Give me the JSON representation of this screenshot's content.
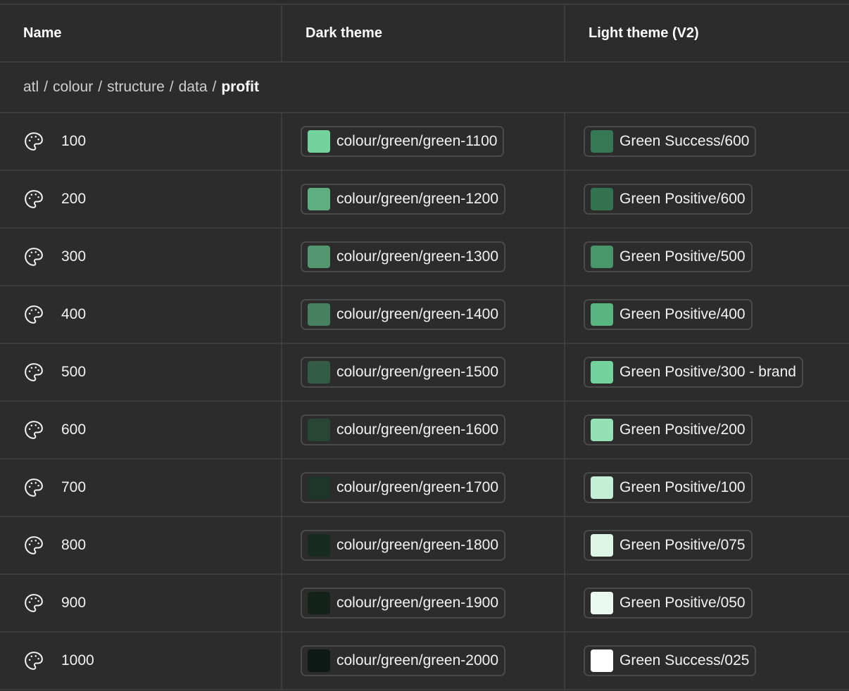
{
  "header": {
    "name": "Name",
    "dark": "Dark theme",
    "light": "Light theme (V2)"
  },
  "breadcrumb": {
    "parts": [
      "atl",
      "colour",
      "structure",
      "data"
    ],
    "separator": "/",
    "current": "profit"
  },
  "icon": "palette-icon",
  "rows": [
    {
      "name": "100",
      "dark": {
        "label": "colour/green/green-1100",
        "color": "#73d39c"
      },
      "light": {
        "label": "Green Success/600",
        "color": "#357853"
      }
    },
    {
      "name": "200",
      "dark": {
        "label": "colour/green/green-1200",
        "color": "#5fae80"
      },
      "light": {
        "label": "Green Positive/600",
        "color": "#337350"
      }
    },
    {
      "name": "300",
      "dark": {
        "label": "colour/green/green-1300",
        "color": "#53966f"
      },
      "light": {
        "label": "Green Positive/500",
        "color": "#48966a"
      }
    },
    {
      "name": "400",
      "dark": {
        "label": "colour/green/green-1400",
        "color": "#46805f"
      },
      "light": {
        "label": "Green Positive/400",
        "color": "#5ab680"
      }
    },
    {
      "name": "500",
      "dark": {
        "label": "colour/green/green-1500",
        "color": "#345b45"
      },
      "light": {
        "label": "Green Positive/300 - brand",
        "color": "#73d39c"
      }
    },
    {
      "name": "600",
      "dark": {
        "label": "colour/green/green-1600",
        "color": "#284535"
      },
      "light": {
        "label": "Green Positive/200",
        "color": "#95e0b5"
      }
    },
    {
      "name": "700",
      "dark": {
        "label": "colour/green/green-1700",
        "color": "#1e3629"
      },
      "light": {
        "label": "Green Positive/100",
        "color": "#c4efd6"
      }
    },
    {
      "name": "800",
      "dark": {
        "label": "colour/green/green-1800",
        "color": "#182b21"
      },
      "light": {
        "label": "Green Positive/075",
        "color": "#dcf5e7"
      }
    },
    {
      "name": "900",
      "dark": {
        "label": "colour/green/green-1900",
        "color": "#13231b"
      },
      "light": {
        "label": "Green Positive/050",
        "color": "#ebfaf1"
      }
    },
    {
      "name": "1000",
      "dark": {
        "label": "colour/green/green-2000",
        "color": "#0e1a15"
      },
      "light": {
        "label": "Green Success/025",
        "color": "#ffffff"
      }
    }
  ]
}
